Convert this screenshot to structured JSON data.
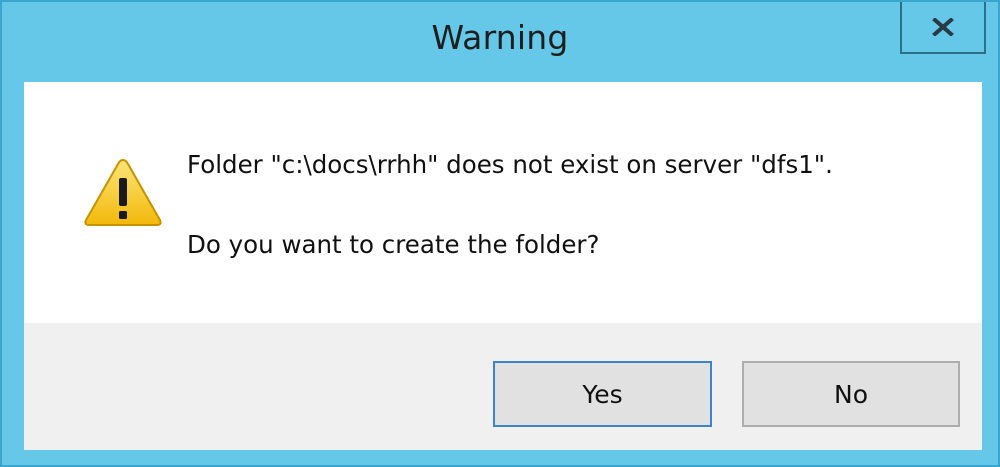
{
  "window": {
    "title": "Warning",
    "close_label": "x"
  },
  "message": {
    "line1": "Folder \"c:\\docs\\rrhh\" does not exist on server \"dfs1\".",
    "line2": "Do you want to create the folder?"
  },
  "buttons": {
    "yes_label": "Yes",
    "no_label": "No"
  },
  "icons": {
    "warning": "warning-triangle-icon",
    "close": "close-icon"
  },
  "colors": {
    "titlebar": "#65c8e9",
    "content_bg": "#ffffff",
    "footer_bg": "#f0f0f0",
    "button_bg": "#e1e1e1",
    "default_button_border": "#3c86c8",
    "warning_yellow": "#f5c400"
  }
}
